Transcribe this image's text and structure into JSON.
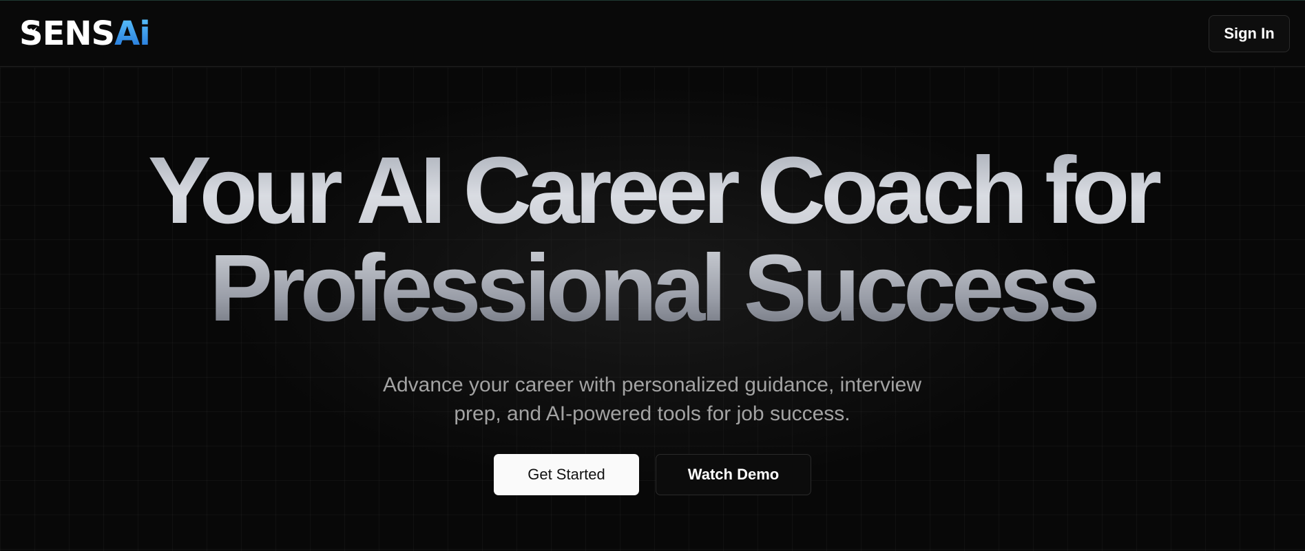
{
  "header": {
    "logo_white": "SENS",
    "logo_blue": "Ai",
    "signin_label": "Sign In"
  },
  "hero": {
    "title_line1": "Your AI Career Coach for",
    "title_line2": "Professional Success",
    "subtitle_line1": "Advance your career with personalized guidance, interview",
    "subtitle_line2": "prep, and AI-powered tools for job success.",
    "primary_label": "Get Started",
    "secondary_label": "Watch Demo"
  },
  "colors": {
    "background": "#080808",
    "accent_blue": "#1f6fd6",
    "primary_button": "#fafafa"
  }
}
